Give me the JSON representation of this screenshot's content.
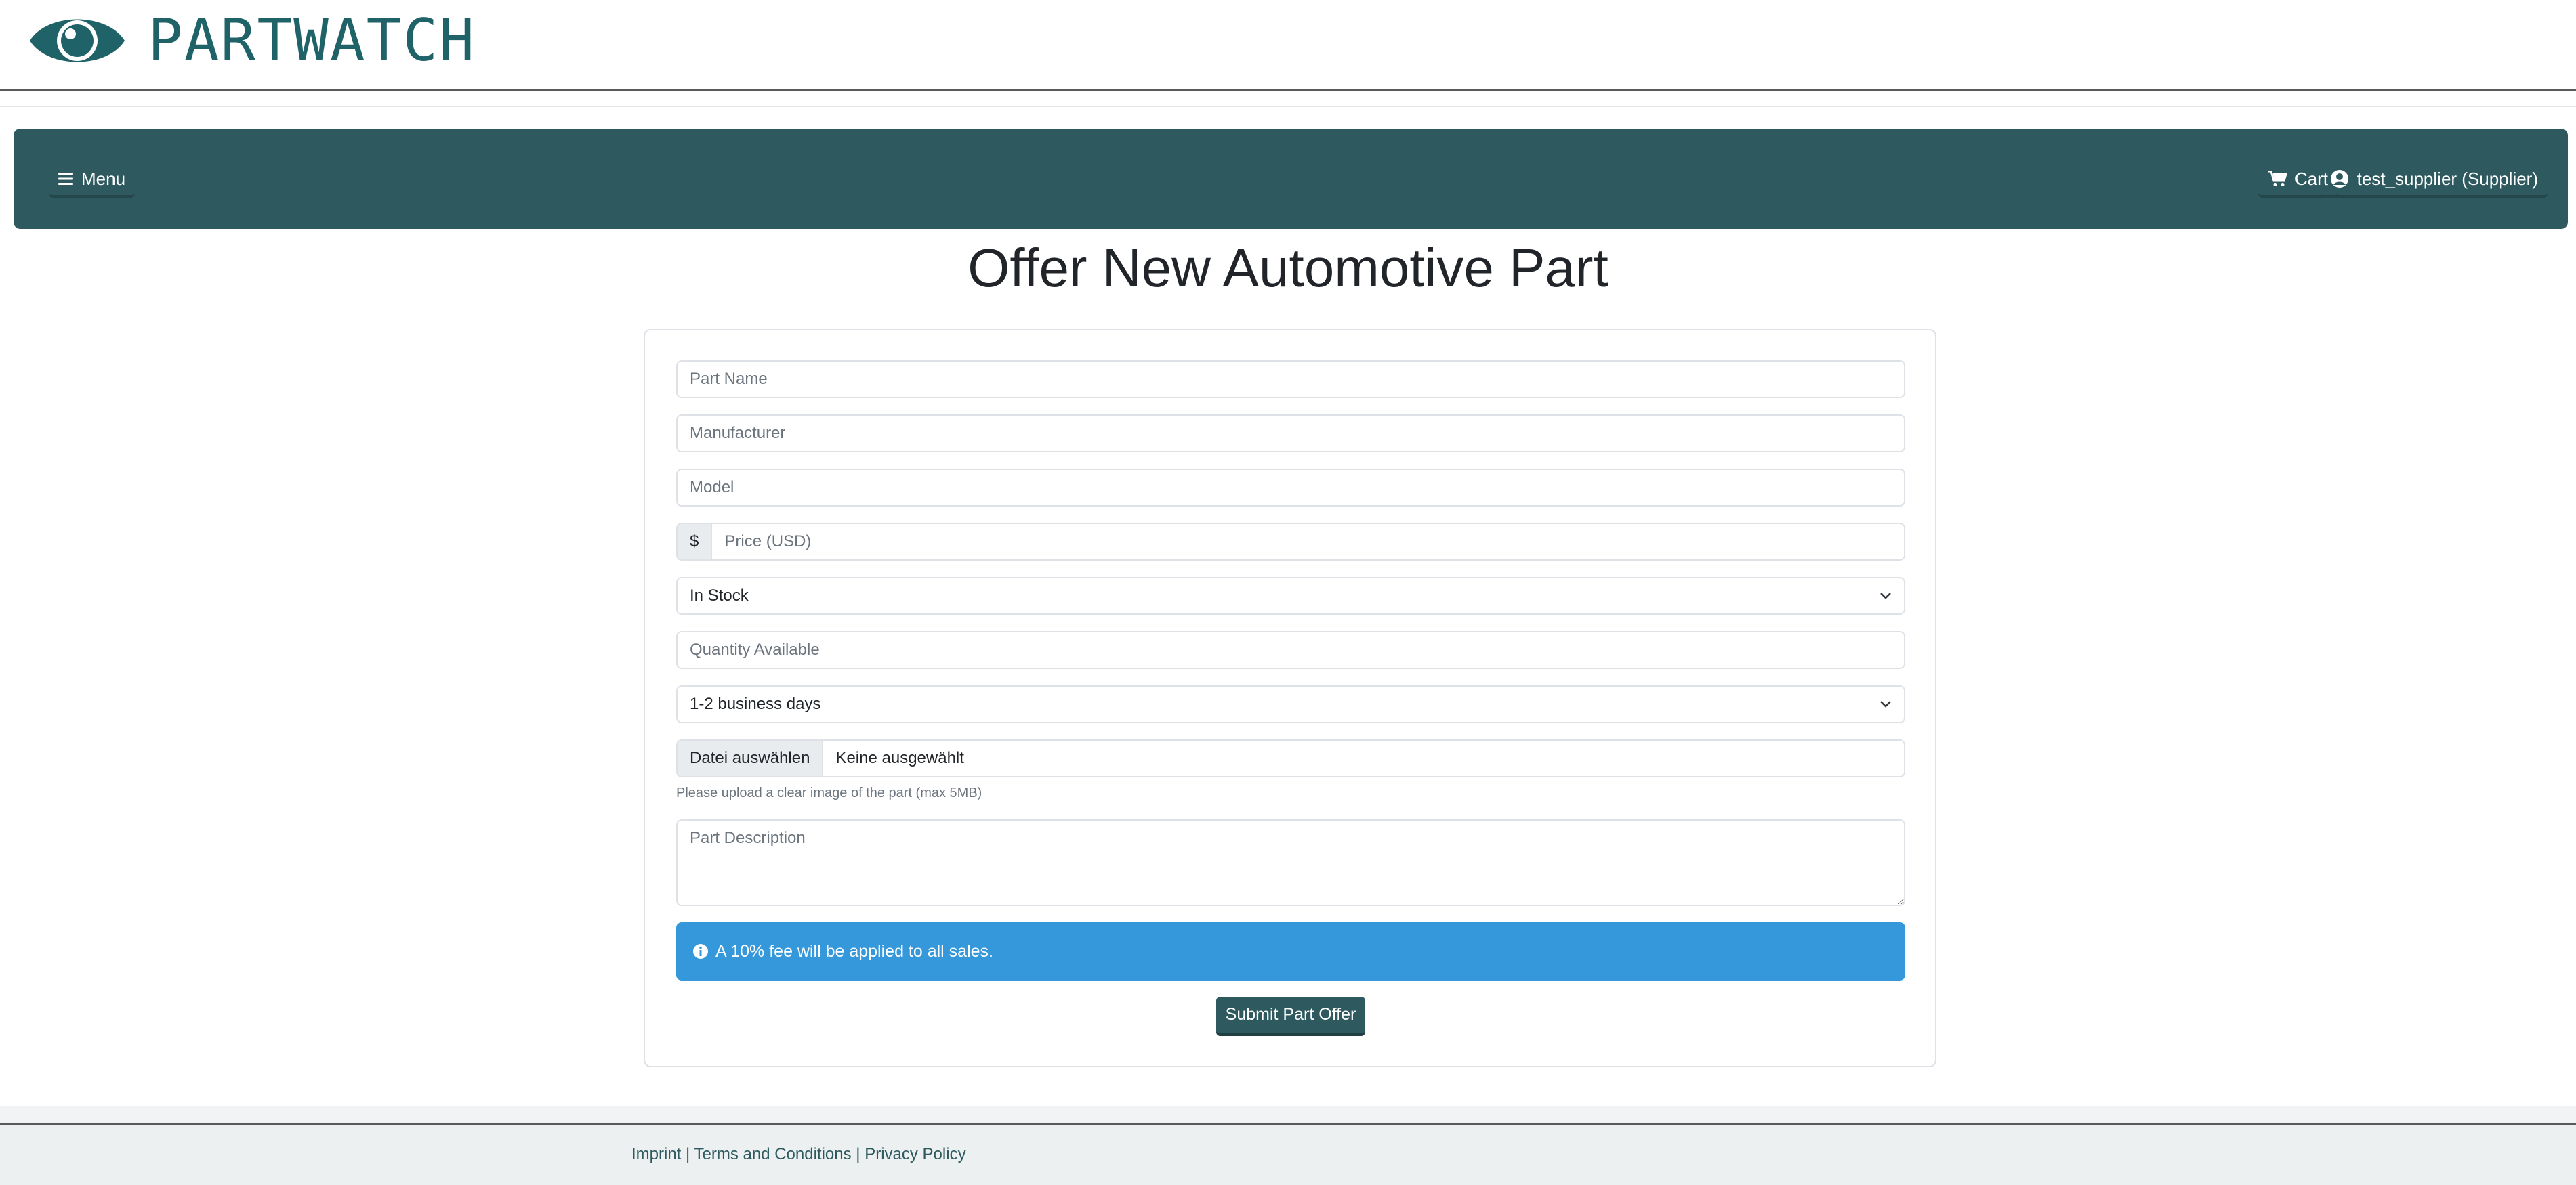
{
  "brand": {
    "name": "PARTWATCH",
    "logo_icon": "eye-icon",
    "color": "#1f6368"
  },
  "navbar": {
    "menu_label": "Menu",
    "cart_label": "Cart",
    "user_label": "test_supplier (Supplier)",
    "background": "#2e5a5f"
  },
  "page": {
    "title": "Offer New Automotive Part"
  },
  "form": {
    "part_name_placeholder": "Part Name",
    "manufacturer_placeholder": "Manufacturer",
    "model_placeholder": "Model",
    "price_prefix": "$",
    "price_placeholder": "Price (USD)",
    "stock_status": "In Stock",
    "quantity_placeholder": "Quantity Available",
    "shipping_time": "1-2 business days",
    "file_button": "Datei auswählen",
    "file_status": "Keine ausgewählt",
    "file_help": "Please upload a clear image of the part (max 5MB)",
    "description_placeholder": "Part Description",
    "fee_notice": "A 10% fee will be applied to all sales.",
    "submit_label": "Submit Part Offer",
    "alert_color": "#3498db"
  },
  "footer": {
    "imprint": "Imprint",
    "terms": "Terms and Conditions",
    "privacy": "Privacy Policy",
    "separator": "|"
  }
}
